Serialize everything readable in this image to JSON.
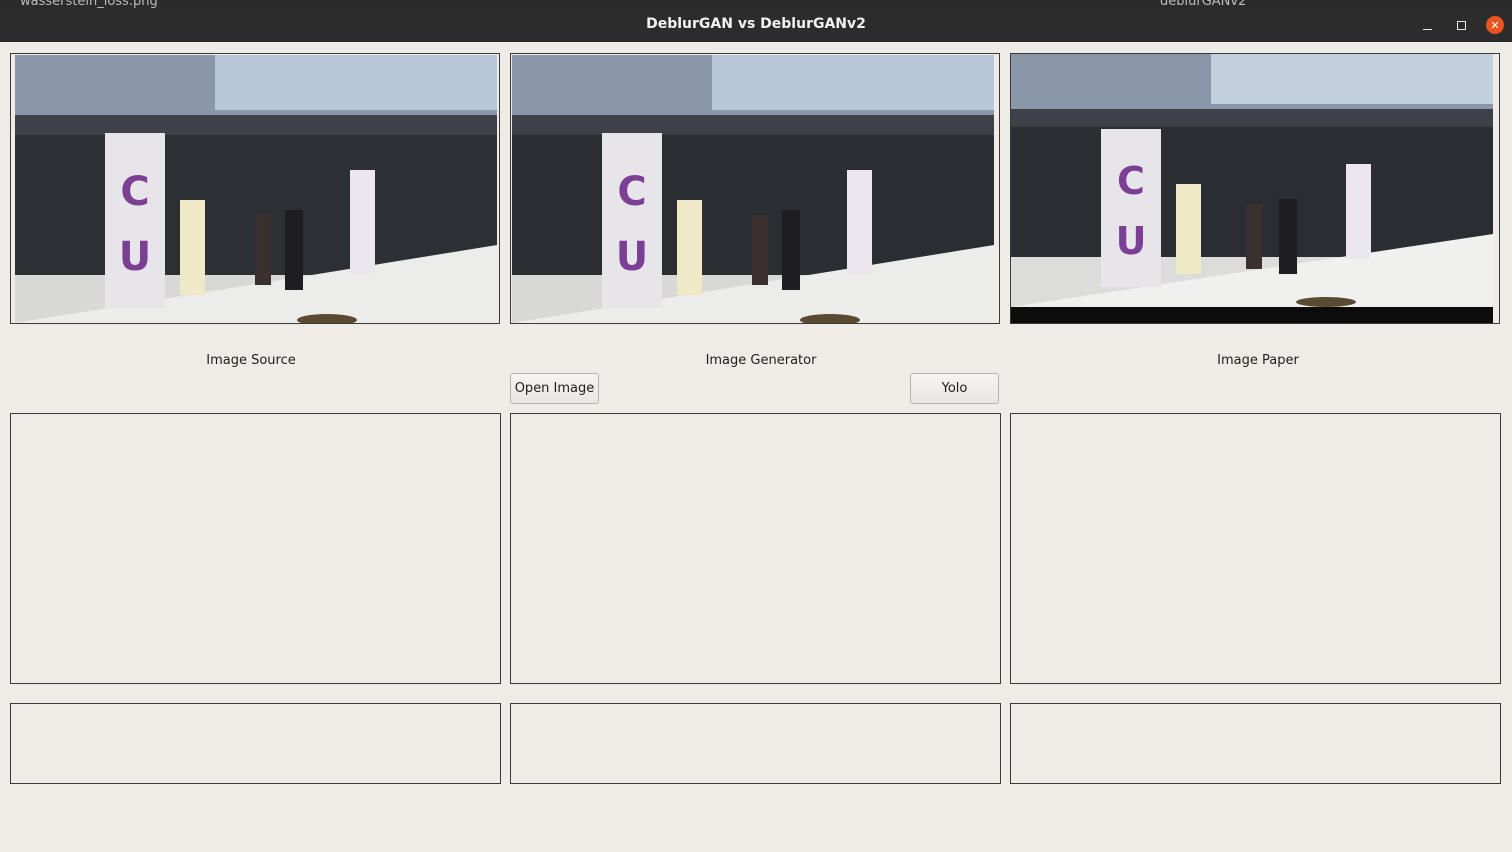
{
  "background": {
    "left_text": "wasserstein_loss.png",
    "right_text": "deblurGANv2"
  },
  "window": {
    "title": "DeblurGAN vs DeblurGANv2",
    "controls": [
      "minimize-icon",
      "maximize-icon",
      "close-icon"
    ]
  },
  "labels": {
    "source": "Image Source",
    "generator": "Image Generator",
    "paper": "Image Paper"
  },
  "buttons": {
    "open_image": "Open Image",
    "yolo": "Yolo"
  },
  "colors": {
    "window_bg": "#efece8",
    "titlebar_bg": "#2c2c2c",
    "close_button": "#e95420"
  }
}
